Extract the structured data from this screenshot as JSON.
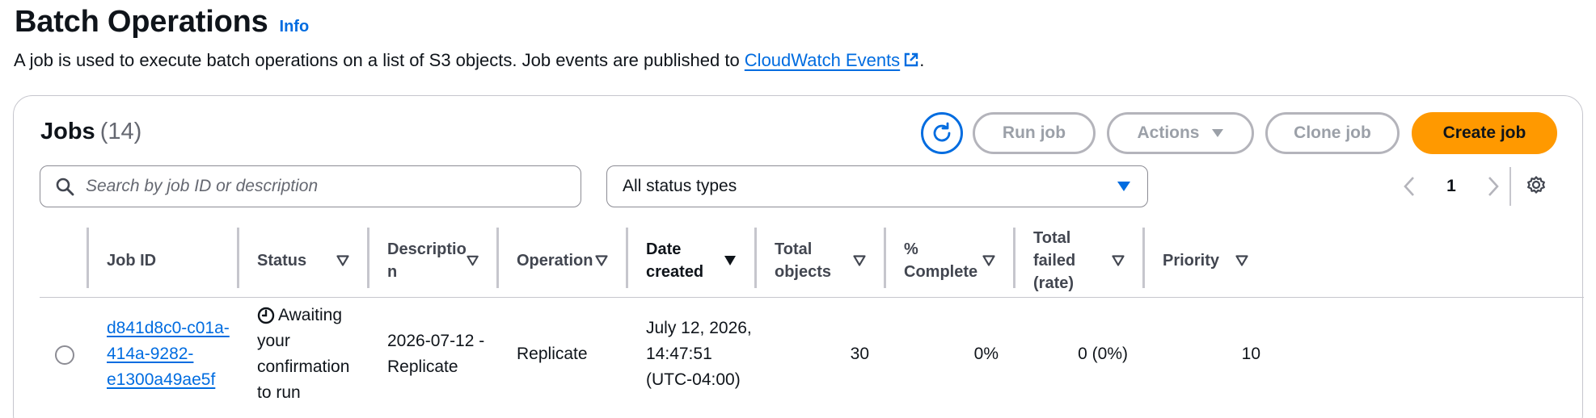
{
  "header": {
    "title": "Batch Operations",
    "info_link": "Info",
    "description_prefix": "A job is used to execute batch operations on a list of S3 objects. Job events are published to ",
    "description_link": "CloudWatch Events",
    "description_suffix": "."
  },
  "jobs": {
    "title": "Jobs",
    "count": "(14)",
    "buttons": {
      "run": "Run job",
      "actions": "Actions",
      "clone": "Clone job",
      "create": "Create job"
    },
    "search": {
      "placeholder": "Search by job ID or description"
    },
    "status_filter": {
      "selected": "All status types"
    },
    "pagination": {
      "current_page": "1"
    },
    "columns": [
      {
        "label": "Job ID"
      },
      {
        "label": "Status"
      },
      {
        "label": "Descriptio\nn"
      },
      {
        "label": "Operation"
      },
      {
        "label": "Date\ncreated"
      },
      {
        "label": "Total\nobjects"
      },
      {
        "label": "%\nComplete"
      },
      {
        "label": "Total\nfailed\n(rate)"
      },
      {
        "label": "Priority"
      }
    ],
    "rows": [
      {
        "job_id": "d841d8c0-c01a-\n414a-9282-\ne1300a49ae5f",
        "status": "Awaiting\nyour\nconfirmation\nto run",
        "description": "2026-07-12 -\nReplicate",
        "operation": "Replicate",
        "date_created": "July 12, 2026,\n14:47:51\n(UTC-04:00)",
        "total_objects": "30",
        "percent_complete": "0%",
        "total_failed": "0 (0%)",
        "priority": "10"
      }
    ]
  },
  "colors": {
    "link": "#006ce0",
    "primary_button": "#ff9900",
    "border": "#c6c6cd"
  },
  "icons": {
    "refresh": "refresh-icon",
    "external": "external-link-icon",
    "search": "search-icon",
    "caret": "caret-down-icon",
    "settings": "gear-icon",
    "status": "clock-icon"
  }
}
